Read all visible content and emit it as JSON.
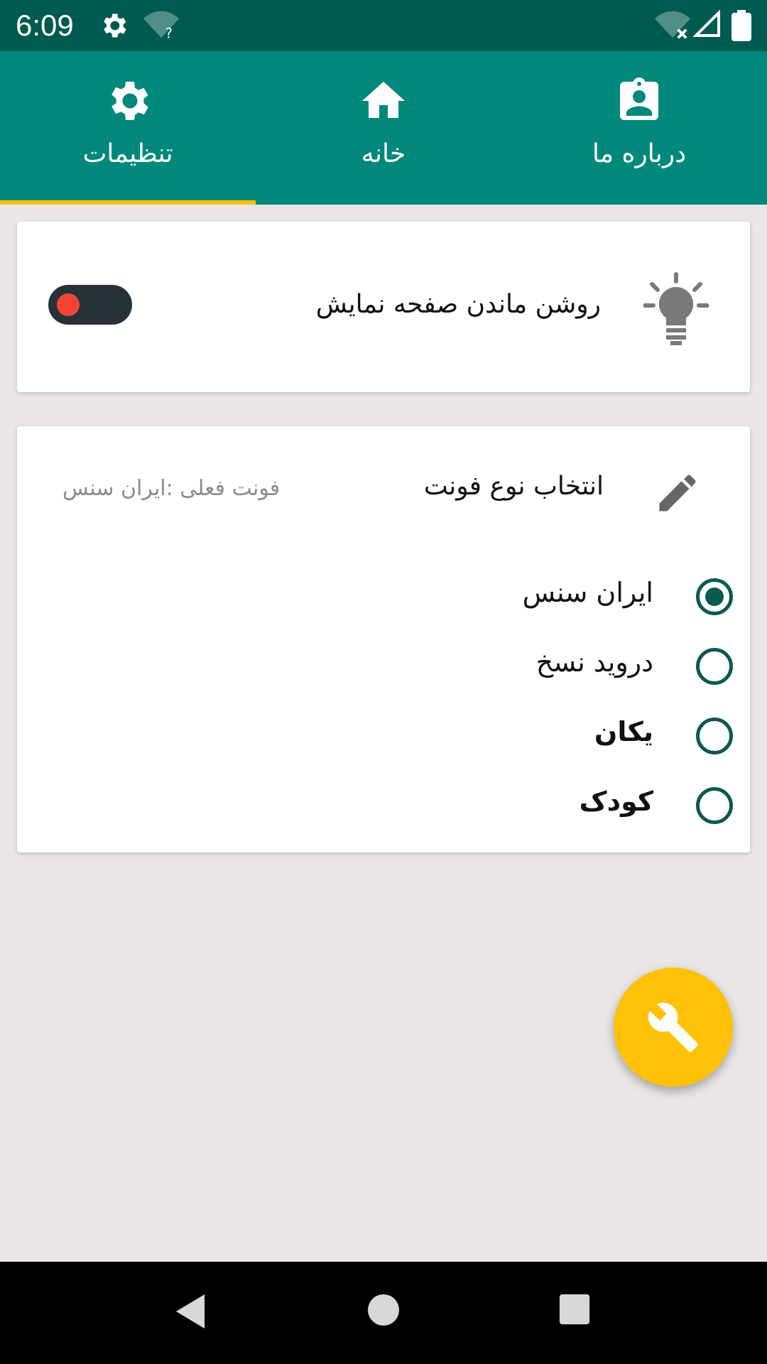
{
  "status_bar": {
    "time": "6:09",
    "icons": [
      "settings-icon",
      "wifi-unknown-icon",
      "wifi-x-icon",
      "signal-icon",
      "battery-icon"
    ],
    "wifi_unknown_mark": "?"
  },
  "tabs": [
    {
      "label": "درباره ما",
      "icon": "account-box-icon"
    },
    {
      "label": "خانه",
      "icon": "home-icon"
    },
    {
      "label": "تنظیمات",
      "icon": "settings-icon",
      "selected": true
    }
  ],
  "screen_on_card": {
    "title": "روشن ماندن صفحه نمایش",
    "icon": "lightbulb-icon",
    "enabled": false
  },
  "font_card": {
    "title": "انتخاب نوع فونت",
    "current_font": "فونت فعلی :ایران سنس",
    "icon": "pencil-icon",
    "options": [
      {
        "label": "ایران سنس",
        "selected": true
      },
      {
        "label": "درويد نسخ",
        "selected": false
      },
      {
        "label": "یکان",
        "selected": false
      },
      {
        "label": "کودک",
        "selected": false
      }
    ]
  },
  "fab": {
    "icon": "wrench-icon"
  },
  "nav": {
    "icons": [
      "back-icon",
      "home-circle-icon",
      "recents-icon"
    ]
  },
  "colors": {
    "status_bar": "#005a4f",
    "toolbar": "#00897b",
    "accent": "#ffc107",
    "radio": "#0b5a4f",
    "toggle_knob": "#f44336"
  }
}
